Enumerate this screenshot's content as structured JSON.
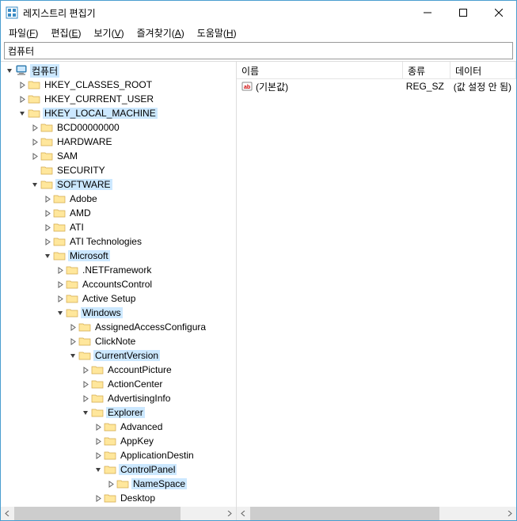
{
  "title": "레지스트리 편집기",
  "menu": {
    "file": "파일(F)",
    "edit": "편집(E)",
    "view": "보기(V)",
    "favorites": "즐겨찾기(A)",
    "help": "도움말(H)"
  },
  "address": "컴퓨터",
  "tree": {
    "root": "컴퓨터",
    "hkcr": "HKEY_CLASSES_ROOT",
    "hkcu": "HKEY_CURRENT_USER",
    "hklm": "HKEY_LOCAL_MACHINE",
    "bcd": "BCD00000000",
    "hardware": "HARDWARE",
    "sam": "SAM",
    "security": "SECURITY",
    "software": "SOFTWARE",
    "adobe": "Adobe",
    "amd": "AMD",
    "ati": "ATI",
    "atitech": "ATI Technologies",
    "microsoft": "Microsoft",
    "netfw": ".NETFramework",
    "accctrl": "AccountsControl",
    "activesetup": "Active Setup",
    "windows": "Windows",
    "assignedaccess": "AssignedAccessConfigura",
    "clicknote": "ClickNote",
    "currentversion": "CurrentVersion",
    "accountpicture": "AccountPicture",
    "actioncenter": "ActionCenter",
    "advertisinginfo": "AdvertisingInfo",
    "explorer": "Explorer",
    "advanced": "Advanced",
    "appkey": "AppKey",
    "appdest": "ApplicationDestin",
    "controlpanel": "ControlPanel",
    "namespace": "NameSpace",
    "desktop": "Desktop"
  },
  "list": {
    "headers": {
      "name": "이름",
      "type": "종류",
      "data": "데이터"
    },
    "row": {
      "name": "(기본값)",
      "type": "REG_SZ",
      "data": "(값 설정 안 됨)"
    }
  }
}
